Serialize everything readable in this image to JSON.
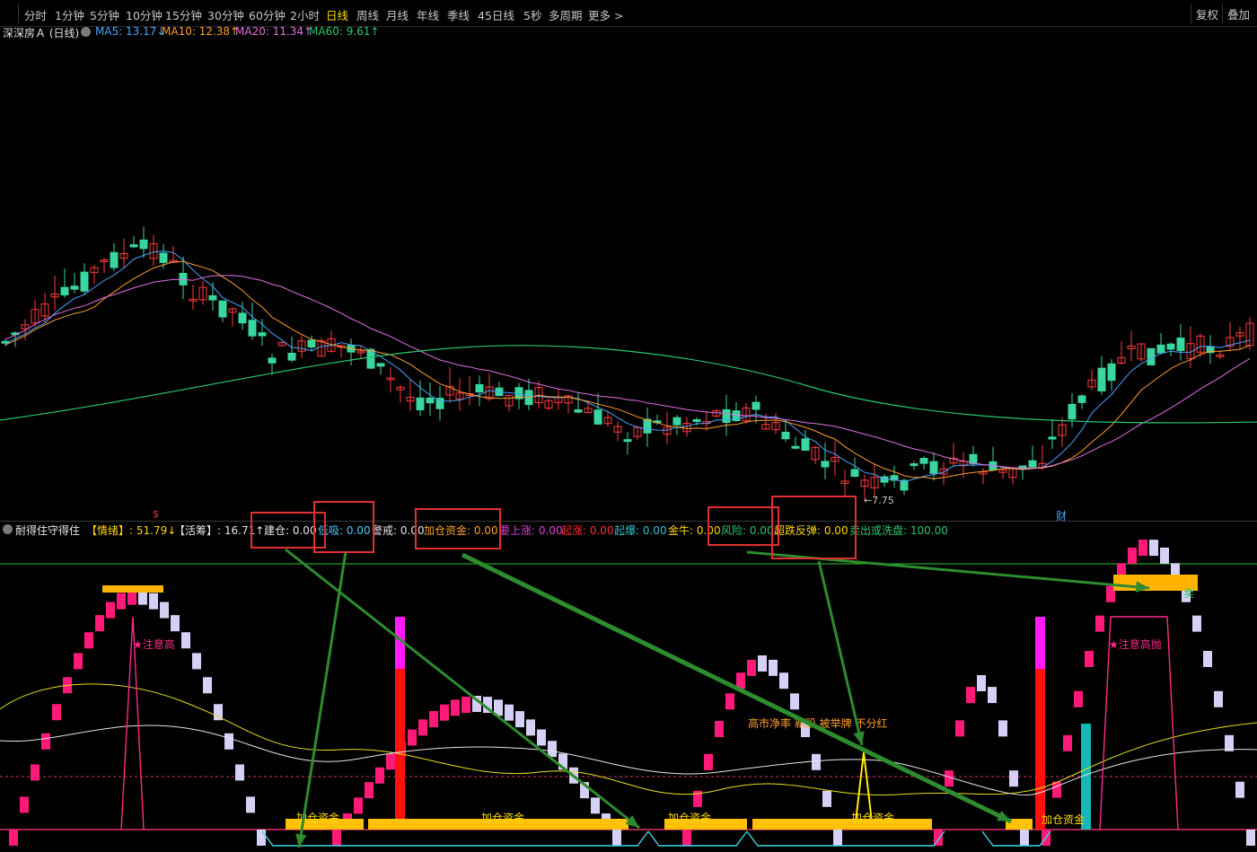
{
  "toolbar": {
    "periods": [
      "分时",
      "1分钟",
      "5分钟",
      "10分钟",
      "15分钟",
      "30分钟",
      "60分钟",
      "2小时",
      "日线",
      "周线",
      "月线",
      "年线",
      "季线",
      "45日线",
      "5秒",
      "多周期",
      "更多 >"
    ],
    "active": "日线",
    "right": [
      "复权",
      "叠加"
    ]
  },
  "legend": {
    "stock": "深深房Ａ (日线)",
    "ma5": "MA5: 13.17↓",
    "ma10": "MA10: 12.38↑",
    "ma20": "MA20: 11.34↑",
    "ma60": "MA60: 9.61↑",
    "colors": {
      "ma5": "#4aa3ff",
      "ma10": "#ff9f2a",
      "ma20": "#e070e0",
      "ma60": "#29c76f"
    }
  },
  "main_chart": {
    "low_label": "←7.75",
    "marker_dollar": "$",
    "marker_cai": "财"
  },
  "indicator_bar": {
    "name": "耐得住守得住",
    "items": [
      {
        "label": "【情绪】: 51.79↓",
        "color": "#ffd800"
      },
      {
        "label": "【活筹】: 16.71↑",
        "color": "#e6e6e6"
      },
      {
        "label": "建仓: 0.00",
        "color": "#e6e6e6"
      },
      {
        "label": "低吸: 0.00",
        "color": "#4ec9ff"
      },
      {
        "label": "警戒: 0.00",
        "color": "#e6e6e6"
      },
      {
        "label": "加仓资金: 0.00",
        "color": "#ff9f2a"
      },
      {
        "label": "要上涨: 0.00",
        "color": "#e040e0"
      },
      {
        "label": "起涨: 0.00",
        "color": "#ff3030"
      },
      {
        "label": "起爆: 0.00",
        "color": "#29c7d0"
      },
      {
        "label": "金牛: 0.00",
        "color": "#ffd800"
      },
      {
        "label": "风险: 0.00",
        "color": "#29c76f"
      },
      {
        "label": "超跌反弹: 0.00",
        "color": "#ffd800"
      },
      {
        "label": "卖出或洗盘: 100.00",
        "color": "#29c76f"
      }
    ]
  },
  "sub_chart": {
    "labels": {
      "attention1": "★注意高",
      "attention2": "★注意高抛",
      "news": "高市净率 新股 被举牌 不分红",
      "sell": "卖",
      "jiacang": [
        "加仓资金",
        "加仓资金",
        "加仓资金",
        "加仓资金",
        "加仓资金"
      ]
    }
  }
}
